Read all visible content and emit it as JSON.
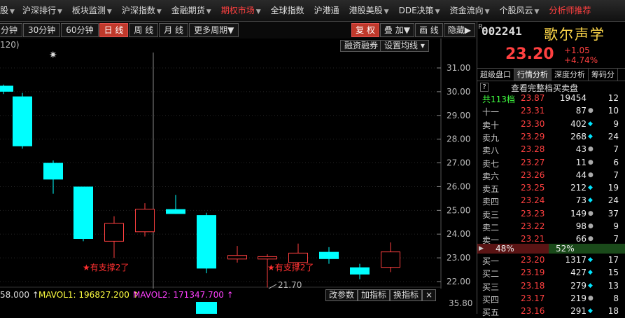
{
  "top_menu": [
    {
      "label": "股",
      "red": false,
      "arrow": true
    },
    {
      "label": "沪深排行",
      "red": false,
      "arrow": true
    },
    {
      "label": "板块监测",
      "red": false,
      "arrow": true
    },
    {
      "label": "沪深指数",
      "red": false,
      "arrow": true
    },
    {
      "label": "金融期货",
      "red": false,
      "arrow": true
    },
    {
      "label": "期权市场",
      "red": true,
      "arrow": true
    },
    {
      "label": "全球指数",
      "red": false,
      "arrow": false
    },
    {
      "label": "沪港通",
      "red": false,
      "arrow": false
    },
    {
      "label": "港股美股",
      "red": false,
      "arrow": true
    },
    {
      "label": "DDE决策",
      "red": false,
      "arrow": true
    },
    {
      "label": "资金流向",
      "red": false,
      "arrow": true
    },
    {
      "label": "个股风云",
      "red": false,
      "arrow": true
    },
    {
      "label": "分析师推荐",
      "red": true,
      "arrow": false
    }
  ],
  "toolbar": {
    "periods": [
      "分钟",
      "30分钟",
      "60分钟",
      "日 线",
      "周 线",
      "月 线",
      "更多周期▼"
    ],
    "active_period": "日 线",
    "right": [
      "复 权",
      "叠 加▼",
      "画 线",
      "隐藏▶"
    ],
    "active_right": "复 权",
    "sub_buttons": [
      "融资融券",
      "设置均线 ▾"
    ]
  },
  "chart": {
    "ma_label": "120)",
    "y_ticks": [
      "31.00",
      "30.00",
      "29.00",
      "28.00",
      "27.00",
      "26.00",
      "25.00",
      "24.00",
      "23.00",
      "22.00"
    ],
    "low_label": "21.70",
    "annotations": [
      "★有支撑2了",
      "★有支撑2了"
    ],
    "star_glyph": "✷",
    "candles": [
      {
        "open": 30.0,
        "close": 30.25,
        "high": 30.3,
        "low": 29.9,
        "up": false
      },
      {
        "open": 29.8,
        "close": 27.7,
        "high": 29.95,
        "low": 27.6,
        "up": false
      },
      {
        "open": 27.0,
        "close": 26.3,
        "high": 27.1,
        "low": 25.7,
        "up": false
      },
      {
        "open": 26.0,
        "close": 23.8,
        "high": 26.0,
        "low": 23.7,
        "up": false
      },
      {
        "open": 23.7,
        "close": 24.45,
        "high": 24.75,
        "low": 23.0,
        "up": true
      },
      {
        "open": 24.1,
        "close": 25.05,
        "high": 25.3,
        "low": 23.9,
        "up": true
      },
      {
        "open": 25.05,
        "close": 24.85,
        "high": 25.65,
        "low": 24.85,
        "up": false
      },
      {
        "open": 24.8,
        "close": 22.55,
        "high": 24.9,
        "low": 22.35,
        "up": false
      },
      {
        "open": 22.95,
        "close": 23.1,
        "high": 23.5,
        "low": 22.8,
        "up": true
      },
      {
        "open": 22.95,
        "close": 23.05,
        "high": 23.15,
        "low": 21.75,
        "up": true
      },
      {
        "open": 22.8,
        "close": 23.2,
        "high": 23.6,
        "low": 22.6,
        "up": true
      },
      {
        "open": 23.25,
        "close": 22.95,
        "high": 23.45,
        "low": 22.75,
        "up": false
      },
      {
        "open": 22.6,
        "close": 22.3,
        "high": 22.75,
        "low": 22.1,
        "up": false
      },
      {
        "open": 22.6,
        "close": 23.25,
        "high": 23.65,
        "low": 22.4,
        "up": true
      }
    ]
  },
  "volume": {
    "vol_text": "58.000 ↑",
    "mavol1_text": "MAVOL1: 196827.200 ↑",
    "mavol2_text": "MAVOL2: 171347.700 ↑",
    "buttons": [
      "改参数",
      "加指标",
      "换指标",
      "×"
    ],
    "scale": "35.80"
  },
  "stock": {
    "prefix": "R",
    "code": "002241",
    "name": "歌尔声学",
    "price": "23.20",
    "change": "+1.05",
    "change_pct": "+4.74%"
  },
  "tabs": [
    "超级盘口",
    "行情分析",
    "深度分析",
    "筹码分"
  ],
  "active_tab": "行情分析",
  "orderbook_title": "查看完整档买卖盘",
  "help_mark": "?",
  "orderbook": [
    {
      "label": "共113档",
      "price": "23.87",
      "vol": "19454",
      "mark": "",
      "count": "12",
      "green": true
    },
    {
      "label": "十一",
      "price": "23.31",
      "vol": "87",
      "mark": "●",
      "count": "10"
    },
    {
      "label": "卖十",
      "price": "23.30",
      "vol": "402",
      "mark": "◆",
      "count": "9"
    },
    {
      "label": "卖九",
      "price": "23.29",
      "vol": "268",
      "mark": "◆",
      "count": "24"
    },
    {
      "label": "卖八",
      "price": "23.28",
      "vol": "43",
      "mark": "●",
      "count": "7"
    },
    {
      "label": "卖七",
      "price": "23.27",
      "vol": "11",
      "mark": "●",
      "count": "6"
    },
    {
      "label": "卖六",
      "price": "23.26",
      "vol": "44",
      "mark": "●",
      "count": "7"
    },
    {
      "label": "卖五",
      "price": "23.25",
      "vol": "212",
      "mark": "◆",
      "count": "19"
    },
    {
      "label": "卖四",
      "price": "23.24",
      "vol": "73",
      "mark": "◆",
      "count": "24"
    },
    {
      "label": "卖三",
      "price": "23.23",
      "vol": "149",
      "mark": "●",
      "count": "37"
    },
    {
      "label": "卖二",
      "price": "23.22",
      "vol": "98",
      "mark": "●",
      "count": "9"
    },
    {
      "label": "卖一",
      "price": "23.21",
      "vol": "66",
      "mark": "●",
      "count": "7"
    }
  ],
  "ratio": {
    "sell": "48%",
    "buy": "52%",
    "sell_fraction": 0.48
  },
  "bids": [
    {
      "label": "买一",
      "price": "23.20",
      "vol": "1317",
      "mark": "◆",
      "count": "17"
    },
    {
      "label": "买二",
      "price": "23.19",
      "vol": "427",
      "mark": "◆",
      "count": "15"
    },
    {
      "label": "买三",
      "price": "23.18",
      "vol": "279",
      "mark": "◆",
      "count": "13"
    },
    {
      "label": "买四",
      "price": "23.17",
      "vol": "219",
      "mark": "●",
      "count": "8"
    },
    {
      "label": "买五",
      "price": "23.16",
      "vol": "291",
      "mark": "◆",
      "count": "18"
    }
  ],
  "colors": {
    "up": "#ff4040",
    "down": "#00ffff",
    "accent": "#c0392b",
    "diamond": "#ff40ff",
    "dot": "#aaaaaa",
    "cyan_mark": "#00e5ff"
  }
}
